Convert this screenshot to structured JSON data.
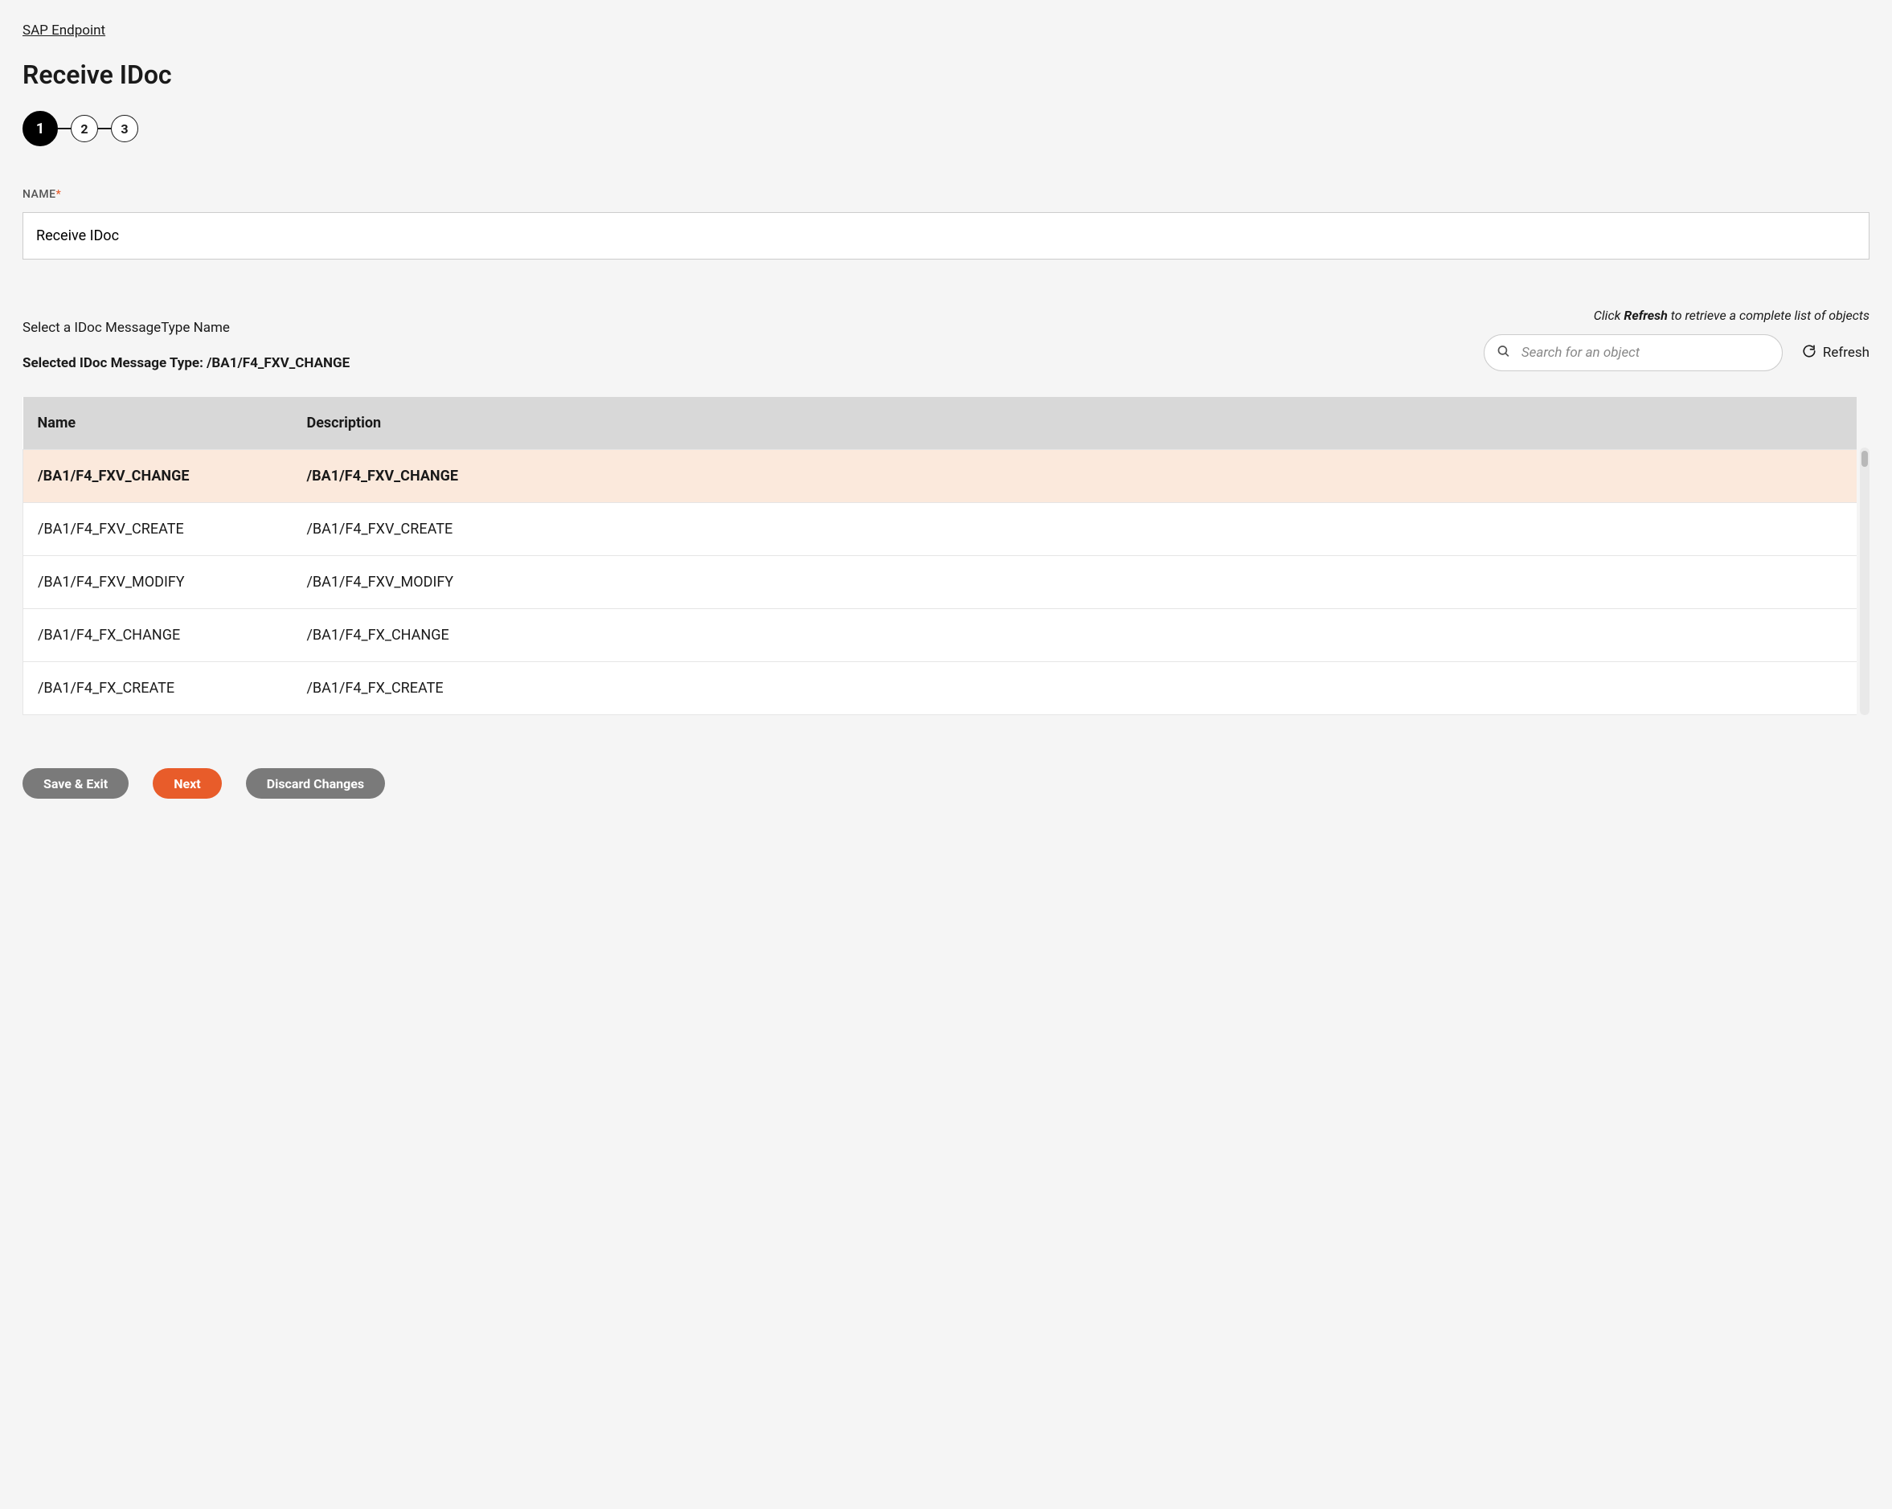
{
  "breadcrumb": "SAP Endpoint",
  "page_title": "Receive IDoc",
  "stepper": {
    "steps": [
      "1",
      "2",
      "3"
    ],
    "active_index": 0
  },
  "name_field": {
    "label": "NAME",
    "required_mark": "*",
    "value": "Receive IDoc"
  },
  "message_type_section": {
    "select_label": "Select a IDoc MessageType Name",
    "selected_prefix": "Selected IDoc Message Type: ",
    "selected_value": "/BA1/F4_FXV_CHANGE",
    "hint_click": "Click ",
    "hint_bold": "Refresh",
    "hint_rest": " to retrieve a complete list of objects",
    "search_placeholder": "Search for an object",
    "refresh_label": "Refresh"
  },
  "table": {
    "headers": {
      "name": "Name",
      "description": "Description"
    },
    "selected_index": 0,
    "rows": [
      {
        "name": "/BA1/F4_FXV_CHANGE",
        "description": "/BA1/F4_FXV_CHANGE"
      },
      {
        "name": "/BA1/F4_FXV_CREATE",
        "description": "/BA1/F4_FXV_CREATE"
      },
      {
        "name": "/BA1/F4_FXV_MODIFY",
        "description": "/BA1/F4_FXV_MODIFY"
      },
      {
        "name": "/BA1/F4_FX_CHANGE",
        "description": "/BA1/F4_FX_CHANGE"
      },
      {
        "name": "/BA1/F4_FX_CREATE",
        "description": "/BA1/F4_FX_CREATE"
      }
    ]
  },
  "buttons": {
    "save_exit": "Save & Exit",
    "next": "Next",
    "discard": "Discard Changes"
  }
}
